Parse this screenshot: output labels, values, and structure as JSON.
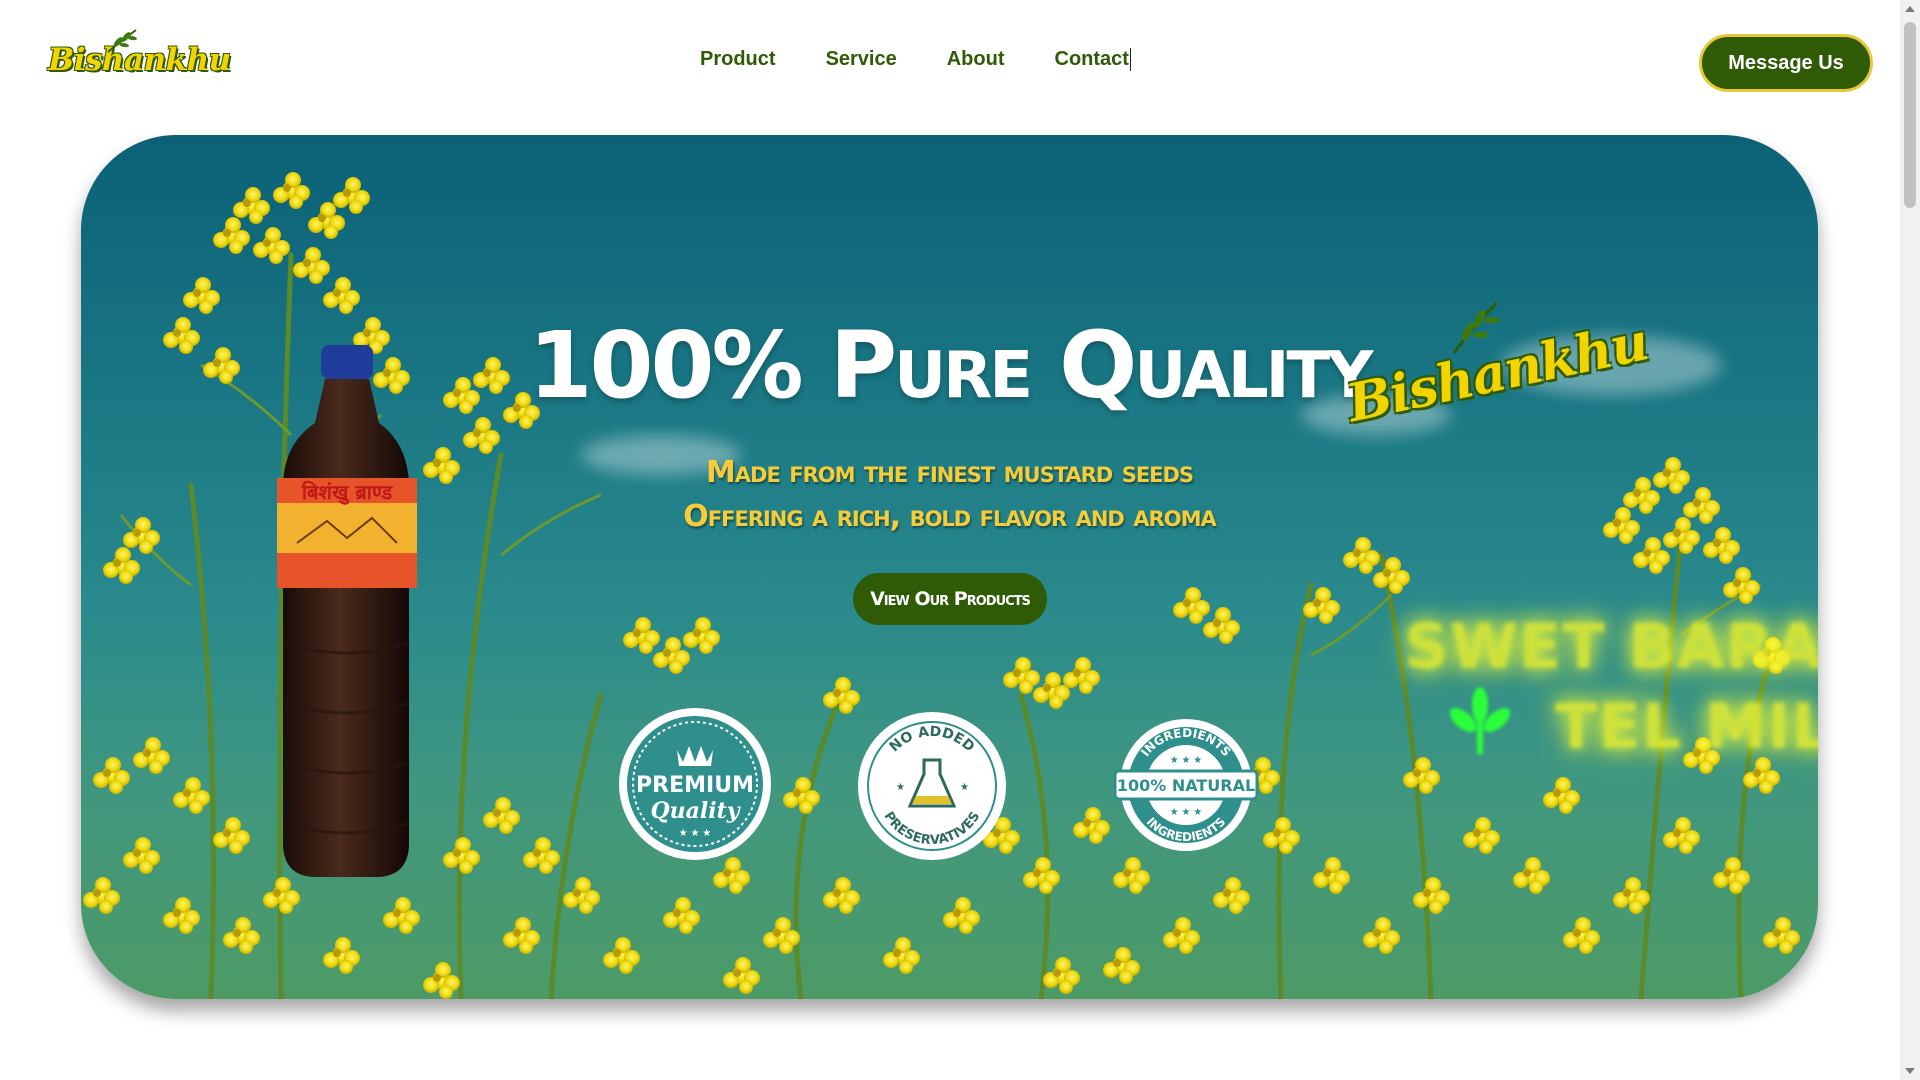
{
  "brand": {
    "logo_text": "Bishankhu"
  },
  "nav": {
    "items": [
      "Product",
      "Service",
      "About",
      "Contact"
    ]
  },
  "header": {
    "message_button": "Message Us"
  },
  "hero": {
    "title": "100% Pure Quality",
    "subtitle_line1": "Made from the finest mustard seeds",
    "subtitle_line2": "Offering a rich, bold flavor and aroma",
    "cta": "View Our Products",
    "logo_text": "Bishankhu",
    "glow_line1": "SWET BARAHAI",
    "glow_line2": "TEL MIL",
    "badges": {
      "premium_top": "PREMIUM",
      "premium_bottom": "Quality",
      "nopres_top": "NO ADDED",
      "nopres_bottom": "PRESERVATIVES",
      "natural_ring_top": "INGREDIENTS",
      "natural_center": "100% NATURAL",
      "natural_ring_bottom": "INGREDIENTS"
    },
    "bottle_label": "बिशंखु ब्राण्ड"
  },
  "colors": {
    "brand_green": "#2f5a06",
    "brand_yellow": "#f1d400",
    "sky_teal": "#1a7784",
    "subtitle_gold": "#f5cc3a"
  }
}
